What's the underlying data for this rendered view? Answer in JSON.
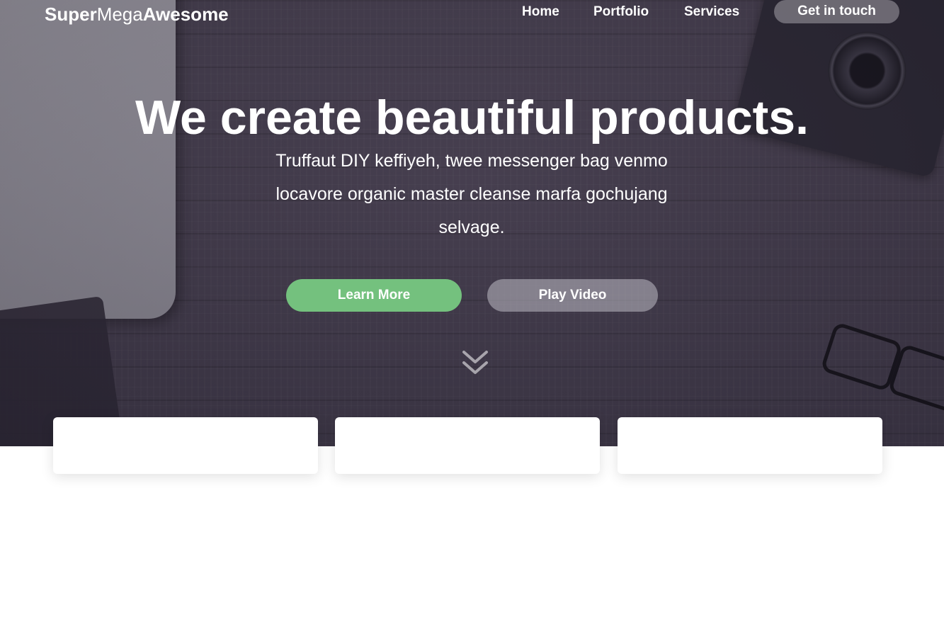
{
  "brand": {
    "part1": "Super",
    "part2": "Mega",
    "part3": "Awesome"
  },
  "nav": {
    "home": "Home",
    "portfolio": "Portfolio",
    "services": "Services",
    "cta": "Get in touch"
  },
  "hero": {
    "headline": "We create beautiful products.",
    "subline": "Truffaut DIY keffiyeh, twee messenger bag venmo locavore organic master cleanse marfa gochujang selvage.",
    "primary_button": "Learn More",
    "secondary_button": "Play Video",
    "scroll_icon": "double-chevron-down-icon"
  },
  "colors": {
    "accent_green": "#74c17e",
    "hero_background": "#443d4d",
    "text": "#ffffff"
  }
}
